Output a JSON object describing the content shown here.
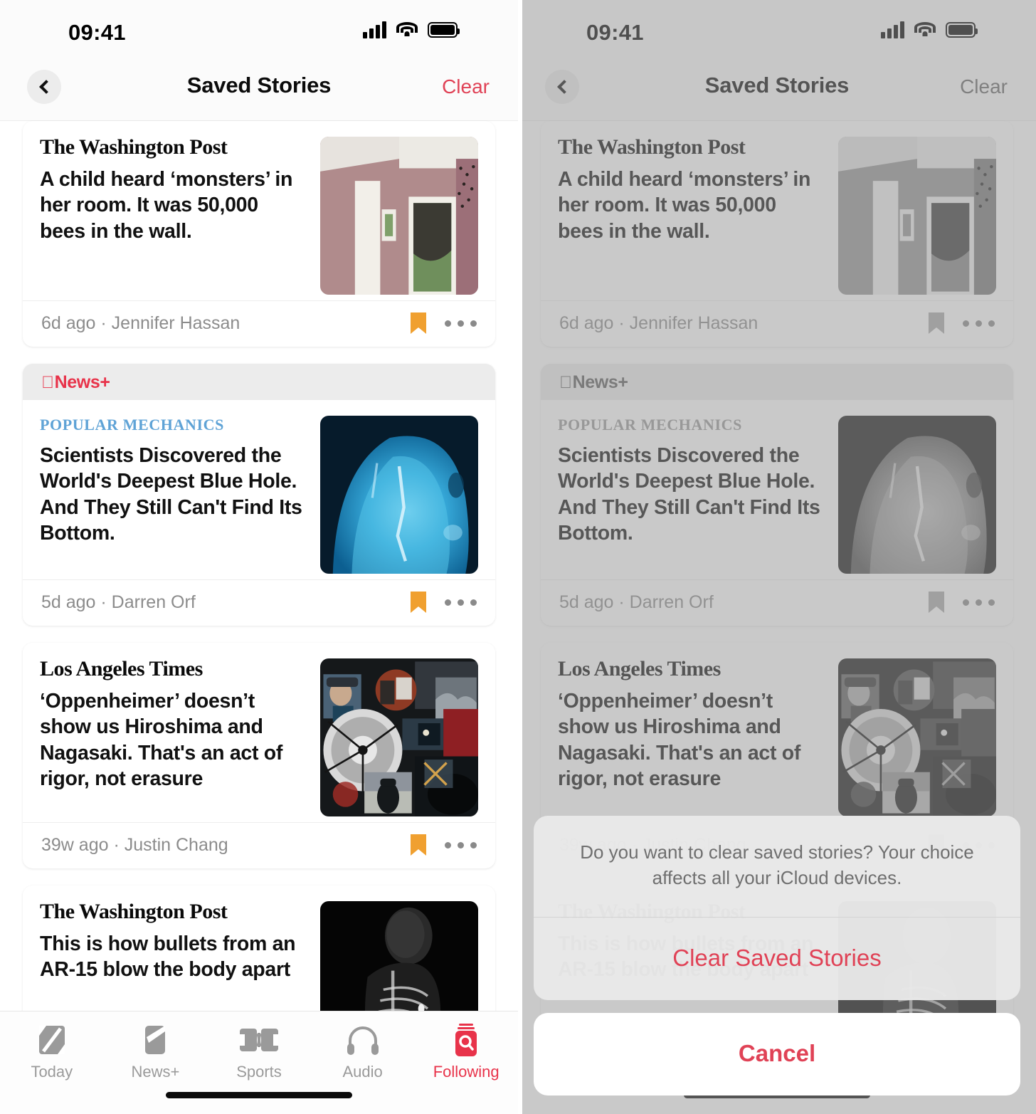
{
  "status_bar": {
    "time": "09:41",
    "signal_icon": "cellular-bars-icon",
    "wifi_icon": "wifi-icon",
    "battery_icon": "battery-full-icon"
  },
  "nav": {
    "back_icon": "chevron-left-icon",
    "title": "Saved Stories",
    "clear_label": "Clear"
  },
  "stories": [
    {
      "publisher": "The Washington Post",
      "kicker": null,
      "news_plus": null,
      "headline": "A child heard ‘monsters’ in her room. It was 50,000 bees in the wall.",
      "time_ago": "6d ago",
      "author": "Jennifer Hassan",
      "meta": "6d ago · Jennifer Hassan",
      "bookmarked": true,
      "thumb": "bedroom-bees-photo"
    },
    {
      "publisher": null,
      "kicker": "POPULAR MECHANICS",
      "news_plus": "News+",
      "headline": "Scientists Discovered the World's Deepest Blue Hole. And They Still Can't Find Its Bottom.",
      "time_ago": "5d ago",
      "author": "Darren Orf",
      "meta": "5d ago · Darren Orf",
      "bookmarked": true,
      "thumb": "blue-hole-underwater-photo"
    },
    {
      "publisher": "Los Angeles Times",
      "kicker": null,
      "news_plus": null,
      "headline": "‘Oppenheimer’ doesn’t show us Hiroshima and Nagasaki. That's an act of rigor, not erasure",
      "time_ago": "39w ago",
      "author": "Justin Chang",
      "meta": "39w ago · Justin Chang",
      "bookmarked": true,
      "thumb": "oppenheimer-collage-photo"
    },
    {
      "publisher": "The Washington Post",
      "kicker": null,
      "news_plus": null,
      "headline": "This is how bullets from an AR-15 blow the body apart",
      "time_ago": null,
      "author": null,
      "meta": null,
      "bookmarked": false,
      "thumb": "xray-torso-photo"
    }
  ],
  "tabs": [
    {
      "label": "Today",
      "icon": "apple-news-n-icon",
      "active": false
    },
    {
      "label": "News+",
      "icon": "news-plus-magazine-icon",
      "active": false
    },
    {
      "label": "Sports",
      "icon": "sports-field-icon",
      "active": false
    },
    {
      "label": "Audio",
      "icon": "headphones-icon",
      "active": false
    },
    {
      "label": "Following",
      "icon": "following-search-icon",
      "active": true
    }
  ],
  "action_sheet": {
    "message": "Do you want to clear saved stories? Your choice affects all your iCloud devices.",
    "destructive_label": "Clear Saved Stories",
    "cancel_label": "Cancel"
  },
  "colors": {
    "accent_red": "#E8334A",
    "clear_red": "#E04256",
    "bookmark_orange": "#F0A030",
    "kicker_blue": "#5FA3D6",
    "muted_gray": "#8c8c8c"
  }
}
